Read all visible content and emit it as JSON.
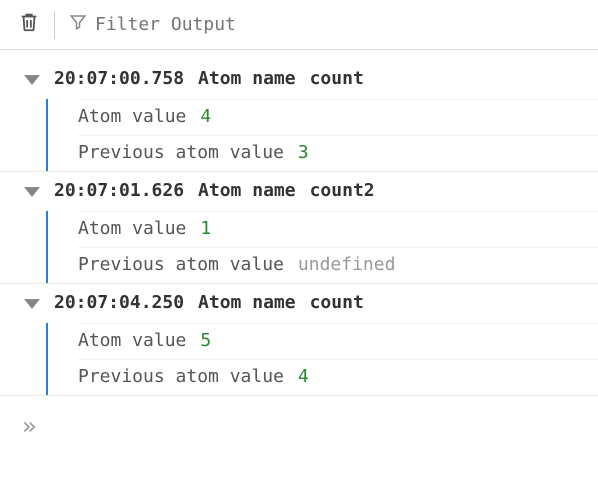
{
  "toolbar": {
    "filter_placeholder": "Filter Output"
  },
  "logs": [
    {
      "timestamp": "20:07:00.758",
      "header_label": "Atom name",
      "name": "count",
      "rows": [
        {
          "key": "Atom value",
          "value": "4",
          "type": "number"
        },
        {
          "key": "Previous atom value",
          "value": "3",
          "type": "number"
        }
      ]
    },
    {
      "timestamp": "20:07:01.626",
      "header_label": "Atom name",
      "name": "count2",
      "rows": [
        {
          "key": "Atom value",
          "value": "1",
          "type": "number"
        },
        {
          "key": "Previous atom value",
          "value": "undefined",
          "type": "undefined"
        }
      ]
    },
    {
      "timestamp": "20:07:04.250",
      "header_label": "Atom name",
      "name": "count",
      "rows": [
        {
          "key": "Atom value",
          "value": "5",
          "type": "number"
        },
        {
          "key": "Previous atom value",
          "value": "4",
          "type": "number"
        }
      ]
    }
  ],
  "prompt": "»"
}
